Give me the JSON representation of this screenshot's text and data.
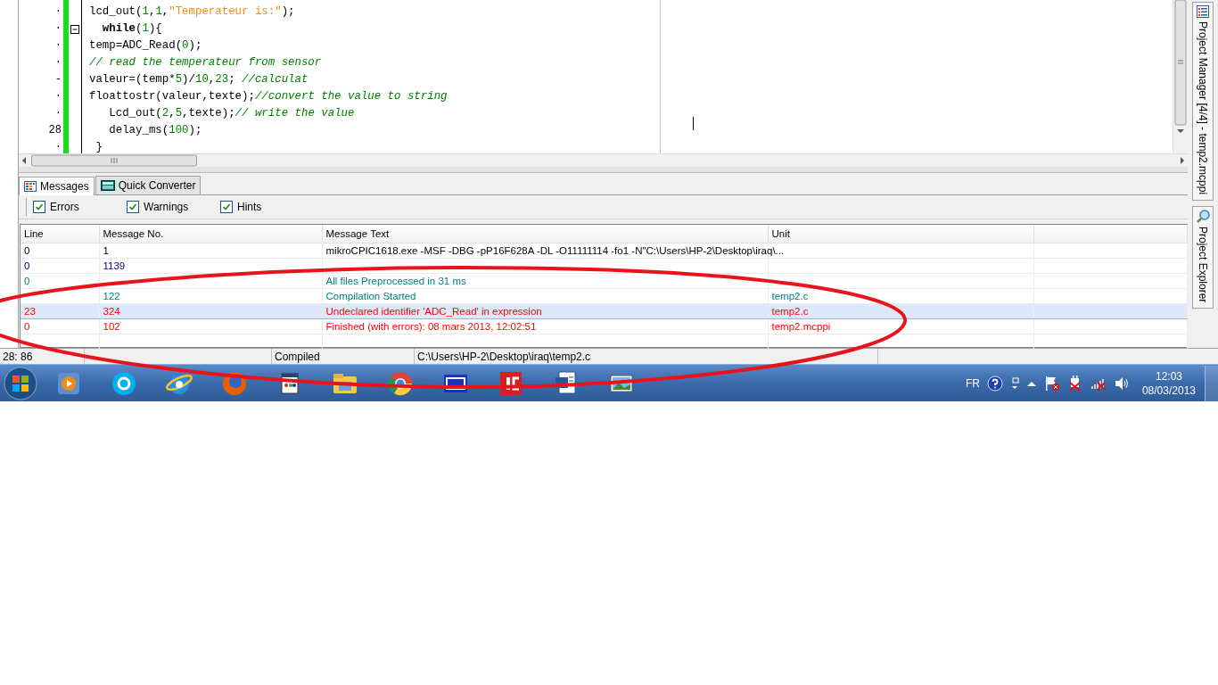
{
  "editor": {
    "lines": [
      {
        "gutter": "·",
        "foldable": false,
        "tokens": [
          {
            "kind": "plain",
            "text": "lcd_out("
          },
          {
            "kind": "number",
            "text": "1"
          },
          {
            "kind": "plain",
            "text": ","
          },
          {
            "kind": "number",
            "text": "1"
          },
          {
            "kind": "plain",
            "text": ","
          },
          {
            "kind": "string",
            "text": "\"Temperateur is:\""
          },
          {
            "kind": "plain",
            "text": ");"
          }
        ]
      },
      {
        "gutter": "·",
        "foldable": true,
        "tokens": [
          {
            "kind": "keyword",
            "text": "  while"
          },
          {
            "kind": "plain",
            "text": "("
          },
          {
            "kind": "number",
            "text": "1"
          },
          {
            "kind": "plain",
            "text": "){"
          }
        ]
      },
      {
        "gutter": "·",
        "foldable": false,
        "tokens": [
          {
            "kind": "plain",
            "text": "temp=ADC_Read("
          },
          {
            "kind": "number",
            "text": "0"
          },
          {
            "kind": "plain",
            "text": ");"
          }
        ]
      },
      {
        "gutter": "·",
        "foldable": false,
        "tokens": [
          {
            "kind": "comment",
            "text": "// read the temperateur from sensor"
          }
        ]
      },
      {
        "gutter": "-",
        "foldable": false,
        "tokens": [
          {
            "kind": "plain",
            "text": "valeur=(temp*"
          },
          {
            "kind": "number",
            "text": "5"
          },
          {
            "kind": "plain",
            "text": ")/"
          },
          {
            "kind": "number",
            "text": "10"
          },
          {
            "kind": "plain",
            "text": ","
          },
          {
            "kind": "number",
            "text": "23"
          },
          {
            "kind": "plain",
            "text": "; "
          },
          {
            "kind": "comment",
            "text": "//calculat"
          }
        ]
      },
      {
        "gutter": "·",
        "foldable": false,
        "tokens": [
          {
            "kind": "plain",
            "text": "floattostr(valeur,texte);"
          },
          {
            "kind": "comment",
            "text": "//convert the value to string"
          }
        ]
      },
      {
        "gutter": "·",
        "foldable": false,
        "tokens": [
          {
            "kind": "plain",
            "text": "   Lcd_out("
          },
          {
            "kind": "number",
            "text": "2"
          },
          {
            "kind": "plain",
            "text": ","
          },
          {
            "kind": "number",
            "text": "5"
          },
          {
            "kind": "plain",
            "text": ",texte);"
          },
          {
            "kind": "comment",
            "text": "// write the value"
          }
        ]
      },
      {
        "gutter": "28",
        "foldable": false,
        "tokens": [
          {
            "kind": "plain",
            "text": "   delay_ms("
          },
          {
            "kind": "number",
            "text": "100"
          },
          {
            "kind": "plain",
            "text": ");"
          }
        ]
      },
      {
        "gutter": "·",
        "foldable": false,
        "tokens": [
          {
            "kind": "plain",
            "text": " }"
          }
        ]
      }
    ]
  },
  "side_tabs": [
    {
      "label": "Project Manager [4/4] - temp2.mcppi"
    },
    {
      "label": "Project Explorer"
    }
  ],
  "panel_tabs": [
    {
      "label": "Messages",
      "selected": true
    },
    {
      "label": "Quick Converter",
      "selected": false
    }
  ],
  "filters": [
    {
      "label": "Errors",
      "checked": true
    },
    {
      "label": "Warnings",
      "checked": true
    },
    {
      "label": "Hints",
      "checked": true
    }
  ],
  "table": {
    "columns": [
      "Line",
      "Message No.",
      "Message Text",
      "Unit"
    ],
    "rows": [
      {
        "cells": [
          "0",
          "1",
          "mikroCPIC1618.exe -MSF -DBG -pP16F628A -DL -O11111114 -fo1 -N\"C:\\Users\\HP-2\\Desktop\\iraq\\...",
          ""
        ],
        "kind": "command",
        "selected": false
      },
      {
        "cells": [
          "0",
          "1139",
          "",
          ""
        ],
        "kind": "info",
        "selected": false
      },
      {
        "cells": [
          "0",
          "",
          "All files Preprocessed in 31 ms",
          ""
        ],
        "kind": "hint",
        "selected": false
      },
      {
        "cells": [
          "",
          "122",
          "Compilation Started",
          "temp2.c"
        ],
        "kind": "hint",
        "selected": false
      },
      {
        "cells": [
          "23",
          "324",
          "Undeclared identifier 'ADC_Read' in expression",
          "temp2.c"
        ],
        "kind": "error",
        "selected": true
      },
      {
        "cells": [
          "0",
          "102",
          "Finished (with errors): 08 mars 2013, 12:02:51",
          "temp2.mcppi"
        ],
        "kind": "error",
        "selected": false
      }
    ]
  },
  "status_bar": [
    "28: 86",
    "Compiled",
    "C:\\Users\\HP-2\\Desktop\\iraq\\temp2.c"
  ],
  "taskbar": {
    "language": "FR",
    "time": "12:03",
    "date": "08/03/2013"
  }
}
